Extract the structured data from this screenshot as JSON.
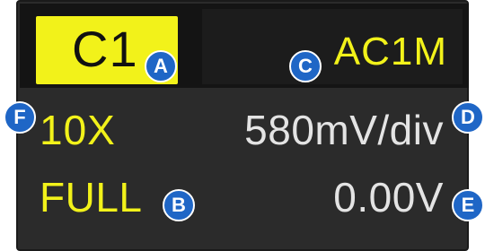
{
  "channel": {
    "label": "C1",
    "coupling": "AC1M",
    "probe_attenuation": "10X",
    "vertical_scale": "580mV/div",
    "bandwidth_limit": "FULL",
    "offset": "0.00V"
  },
  "callouts": {
    "a": "A",
    "b": "B",
    "c": "C",
    "d": "D",
    "e": "E",
    "f": "F"
  },
  "colors": {
    "channel_yellow": "#f2f21a",
    "panel_bg": "#2b2b2b",
    "value_white": "#e4e4e4",
    "callout_blue": "#1f66c6"
  }
}
